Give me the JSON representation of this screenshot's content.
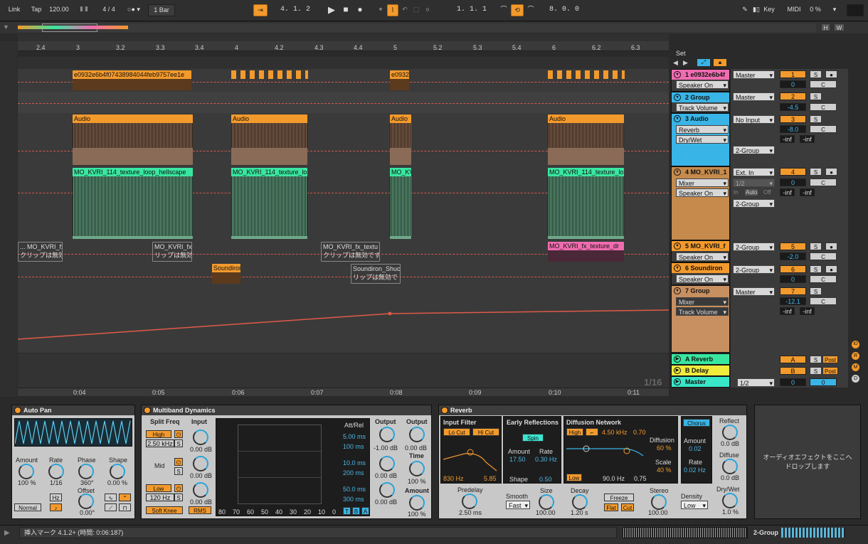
{
  "transport": {
    "link": "Link",
    "tap": "Tap",
    "tempo": "120.00",
    "signature": "4 / 4",
    "quant": "1 Bar",
    "position": "4.   1.   2",
    "loop_start": "1.   1.   1",
    "loop_length": "8.   0.   0",
    "key": "Key",
    "midi": "MIDI",
    "cpu": "0 %"
  },
  "overview": {
    "h": "H",
    "w": "W"
  },
  "ruler": {
    "labels": [
      "2.4",
      "3",
      "3.2",
      "3.3",
      "3.4",
      "4",
      "4.2",
      "4.3",
      "4.4",
      "5",
      "5.2",
      "5.3",
      "5.4",
      "6",
      "6.2",
      "6.3"
    ],
    "set": "Set"
  },
  "time_ruler": {
    "labels": [
      "0:04",
      "0:05",
      "0:06",
      "0:07",
      "0:08",
      "0:09",
      "0:10",
      "0:11"
    ],
    "grid": "1/16"
  },
  "clips": {
    "t1": "e0932e6b4f07438984044feb9757ee1e",
    "t1_short": "e0932",
    "audio": "Audio",
    "mo1": "MO_KVRI_114_texture_loop_hellscape",
    "mo2": "MO_KVRI_114_texture_lo",
    "mo3": "MO_KV",
    "mo4": "MO_KVRI_114_texture_lo",
    "t5a": "... MO_KVRI_fx",
    "t5b": "MO_KVRI_fx",
    "t5c": "MO_KVRI_fx_textu",
    "t5d": "MO_KVRI_fx_texture_dr",
    "disabled": "クリップは無効です",
    "disabled_short": "リップは無効",
    "disabled_c": "クリップは無効です",
    "t6a": "Soundiron",
    "t6b": "Soundiron_Shuc",
    "t6b_dis": "リップは無効で"
  },
  "tracks": [
    {
      "name": "1 e0932e6b4f",
      "color": "#f06cb0",
      "dd1": "Speaker On",
      "route": "Master",
      "num": "1",
      "vol": "0",
      "pan": "C"
    },
    {
      "name": "2 Group",
      "color": "#39b4e6",
      "dd1": "Track Volume",
      "route": "Master",
      "num": "2",
      "vol": "-4.5",
      "pan": "C"
    },
    {
      "name": "3 Audio",
      "color": "#39b4e6",
      "dd1": "Reverb",
      "dd2": "Dry/Wet",
      "route": "No Input",
      "route2": "2-Group",
      "num": "3",
      "vol": "-8.0",
      "pan": "C",
      "send_a": "-inf",
      "send_b": "-inf"
    },
    {
      "name": "4 MO_KVRI_1",
      "color": "#f39a2c",
      "dd1": "Mixer",
      "dd2": "Speaker On",
      "route": "Ext. In",
      "route_sub": "1/2",
      "route2": "2-Group",
      "num": "4",
      "vol": "0",
      "pan": "C",
      "send_a": "-inf",
      "send_b": "-inf",
      "mon_in": "In",
      "mon_auto": "Auto",
      "mon_off": "Off"
    },
    {
      "name": "5 MO_KVRI_f",
      "color": "#f39a2c",
      "dd1": "Speaker On",
      "route": "2-Group",
      "num": "5",
      "vol": "-2.0",
      "pan": "C"
    },
    {
      "name": "6 Soundiron",
      "color": "#f39a2c",
      "dd1": "Speaker On",
      "route": "2-Group",
      "num": "6",
      "vol": "0",
      "pan": "C"
    },
    {
      "name": "7 Group",
      "color": "#c89060",
      "dd1": "Mixer",
      "dd2": "Track Volume",
      "route": "Master",
      "num": "7",
      "vol": "-12.1",
      "pan": "C",
      "send_a": "-inf",
      "send_b": "-inf"
    }
  ],
  "returns": [
    {
      "name": "A Reverb",
      "letter": "A",
      "post": "Post"
    },
    {
      "name": "B Delay",
      "letter": "B",
      "post": "Post"
    }
  ],
  "master": {
    "name": "Master",
    "route": "1/2",
    "vol": "0",
    "pan": "0"
  },
  "mixer_btns": {
    "s": "S",
    "c": "C"
  },
  "autopan": {
    "title": "Auto Pan",
    "amount_l": "Amount",
    "amount": "100 %",
    "rate_l": "Rate",
    "rate": "1/16",
    "phase_l": "Phase",
    "phase": "360°",
    "shape_l": "Shape",
    "shape": "0.00 %",
    "hz": "Hz",
    "offset_l": "Offset",
    "offset": "0.00°",
    "mode": "Normal"
  },
  "multiband": {
    "title": "Multiband Dynamics",
    "split": "Split Freq",
    "input": "Input",
    "high": "High",
    "high_f": "2.50 kHz",
    "high_in": "0.00 dB",
    "mid": "Mid",
    "mid_in": "0.00 dB",
    "low": "Low",
    "low_f": "120 Hz",
    "low_in": "0.00 dB",
    "soft": "Soft Knee",
    "rms": "RMS",
    "attrel": "Att/Rel",
    "t1": "5.00 ms",
    "t2": "100 ms",
    "t3": "10.0 ms",
    "t4": "200 ms",
    "t5": "50.0 ms",
    "t6": "300 ms",
    "output": "Output",
    "o1": "-1.00 dB",
    "o2": "0.00 dB",
    "o3": "0.00 dB",
    "out2": "Output",
    "out2_v": "0.00 dB",
    "time": "Time",
    "time_v": "100 %",
    "amount": "Amount",
    "amount_v": "100 %",
    "scale": [
      "80",
      "70",
      "60",
      "50",
      "40",
      "30",
      "20",
      "10",
      "0"
    ],
    "tba": [
      "T",
      "B",
      "A"
    ],
    "s": "S"
  },
  "reverb": {
    "title": "Reverb",
    "input_filter": "Input Filter",
    "locut": "Lo Cut",
    "hicut": "Hi Cut",
    "f1": "830 Hz",
    "f2": "5.85",
    "predelay_l": "Predelay",
    "predelay": "2.50 ms",
    "early": "Early Reflections",
    "spin": "Spin",
    "amount_l": "Amount",
    "amount": "17.50",
    "rate_l": "Rate",
    "rate": "0.30 Hz",
    "shape_l": "Shape",
    "shape": "0.50",
    "smooth_l": "Smooth",
    "smooth": "Fast",
    "diffusion_net": "Diffusion Network",
    "high": "High",
    "high_f": "4.50 kHz",
    "high_v": "0.70",
    "low": "Low",
    "low_f": "90.0 Hz",
    "low_v": "0.75",
    "diffusion_l": "Diffusion",
    "diffusion": "60 %",
    "scale_l": "Scale",
    "scale": "40 %",
    "chorus": "Chorus",
    "ch_amount_l": "Amount",
    "ch_amount": "0.02",
    "ch_rate_l": "Rate",
    "ch_rate": "0.02 Hz",
    "size_l": "Size",
    "size": "100.00",
    "decay_l": "Decay",
    "decay": "1.20 s",
    "freeze": "Freeze",
    "flat": "Flat",
    "cut": "Cut",
    "stereo_l": "Stereo",
    "stereo": "100.00",
    "density_l": "Density",
    "density": "Low",
    "reflect_l": "Reflect",
    "reflect": "0.0 dB",
    "diffuse_l": "Diffuse",
    "diffuse": "0.0 dB",
    "drywet_l": "Dry/Wet",
    "drywet": "1.0 %"
  },
  "drop_hint": "オーディオエフェクトをここへドロップします",
  "status": {
    "text": "挿入マーク 4.1.2+ (時間: 0:06:187)",
    "track": "2-Group"
  },
  "side_badges": [
    "IO",
    "R",
    "M",
    "D"
  ]
}
